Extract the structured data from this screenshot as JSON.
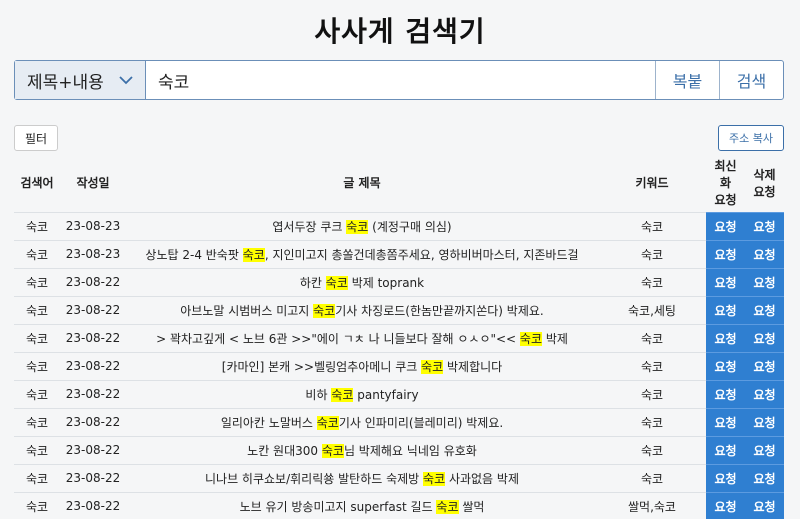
{
  "app": {
    "title": "사사게 검색기"
  },
  "search": {
    "mode": "제목+내용",
    "query": "숙코",
    "paste_label": "복붙",
    "search_label": "검색"
  },
  "toolbar": {
    "filter_label": "필터",
    "copy_label": "주소 복사"
  },
  "table": {
    "headers": {
      "term": "검색어",
      "date": "작성일",
      "title": "글 제목",
      "keyword": "키워드",
      "refresh": "최신\n화\n요청",
      "delete": "삭제\n요청"
    },
    "request_label": "요청",
    "rows": [
      {
        "term": "숙코",
        "date": "23-08-23",
        "title_pre": "엽서두장 쿠크 ",
        "title_hl": "숙코",
        "title_post": " (계정구매 의심)",
        "keyword": "숙코"
      },
      {
        "term": "숙코",
        "date": "23-08-23",
        "title_pre": "상노탑 2-4 반숙팟 ",
        "title_hl": "숙코",
        "title_post": ", 지인미고지 총쏠건데총쫌주세요, 영하비버마스터, 지존바드걸",
        "keyword": "숙코"
      },
      {
        "term": "숙코",
        "date": "23-08-22",
        "title_pre": "하칸 ",
        "title_hl": "숙코",
        "title_post": " 박제 toprank",
        "keyword": "숙코"
      },
      {
        "term": "숙코",
        "date": "23-08-22",
        "title_pre": "아브노말 시범버스 미고지 ",
        "title_hl": "숙코",
        "title_post": "기사 차징로드(한놈만끝까지쏜다) 박제요.",
        "keyword": "숙코,세팅"
      },
      {
        "term": "숙코",
        "date": "23-08-22",
        "title_pre": "> 꽉차고깊게 < 노브 6관 >>\"에이 ㄱㅊ 나 니들보다 잘해 ㅇㅅㅇ\"<< ",
        "title_hl": "숙코",
        "title_post": " 박제",
        "keyword": "숙코"
      },
      {
        "term": "숙코",
        "date": "23-08-22",
        "title_pre": "[카마인] 본캐 >>벨링엄추아메니 쿠크 ",
        "title_hl": "숙코",
        "title_post": " 박제합니다",
        "keyword": "숙코"
      },
      {
        "term": "숙코",
        "date": "23-08-22",
        "title_pre": "비하 ",
        "title_hl": "숙코",
        "title_post": " pantyfairy",
        "keyword": "숙코"
      },
      {
        "term": "숙코",
        "date": "23-08-22",
        "title_pre": "일리아칸 노말버스 ",
        "title_hl": "숙코",
        "title_post": "기사 인파미리(블레미리) 박제요.",
        "keyword": "숙코"
      },
      {
        "term": "숙코",
        "date": "23-08-22",
        "title_pre": "노칸 원대300 ",
        "title_hl": "숙코",
        "title_post": "님 박제해요 닉네임 유호화",
        "keyword": "숙코"
      },
      {
        "term": "숙코",
        "date": "23-08-22",
        "title_pre": "니나브 히쿠쇼보/휘리릭쑝 발탄하드 숙제방 ",
        "title_hl": "숙코",
        "title_post": " 사과없음 박제",
        "keyword": "숙코"
      },
      {
        "term": "숙코",
        "date": "23-08-22",
        "title_pre": "노브 유기 방송미고지 superfast 길드 ",
        "title_hl": "숙코",
        "title_post": " 쌀먹",
        "keyword": "쌀먹,숙코"
      }
    ]
  }
}
